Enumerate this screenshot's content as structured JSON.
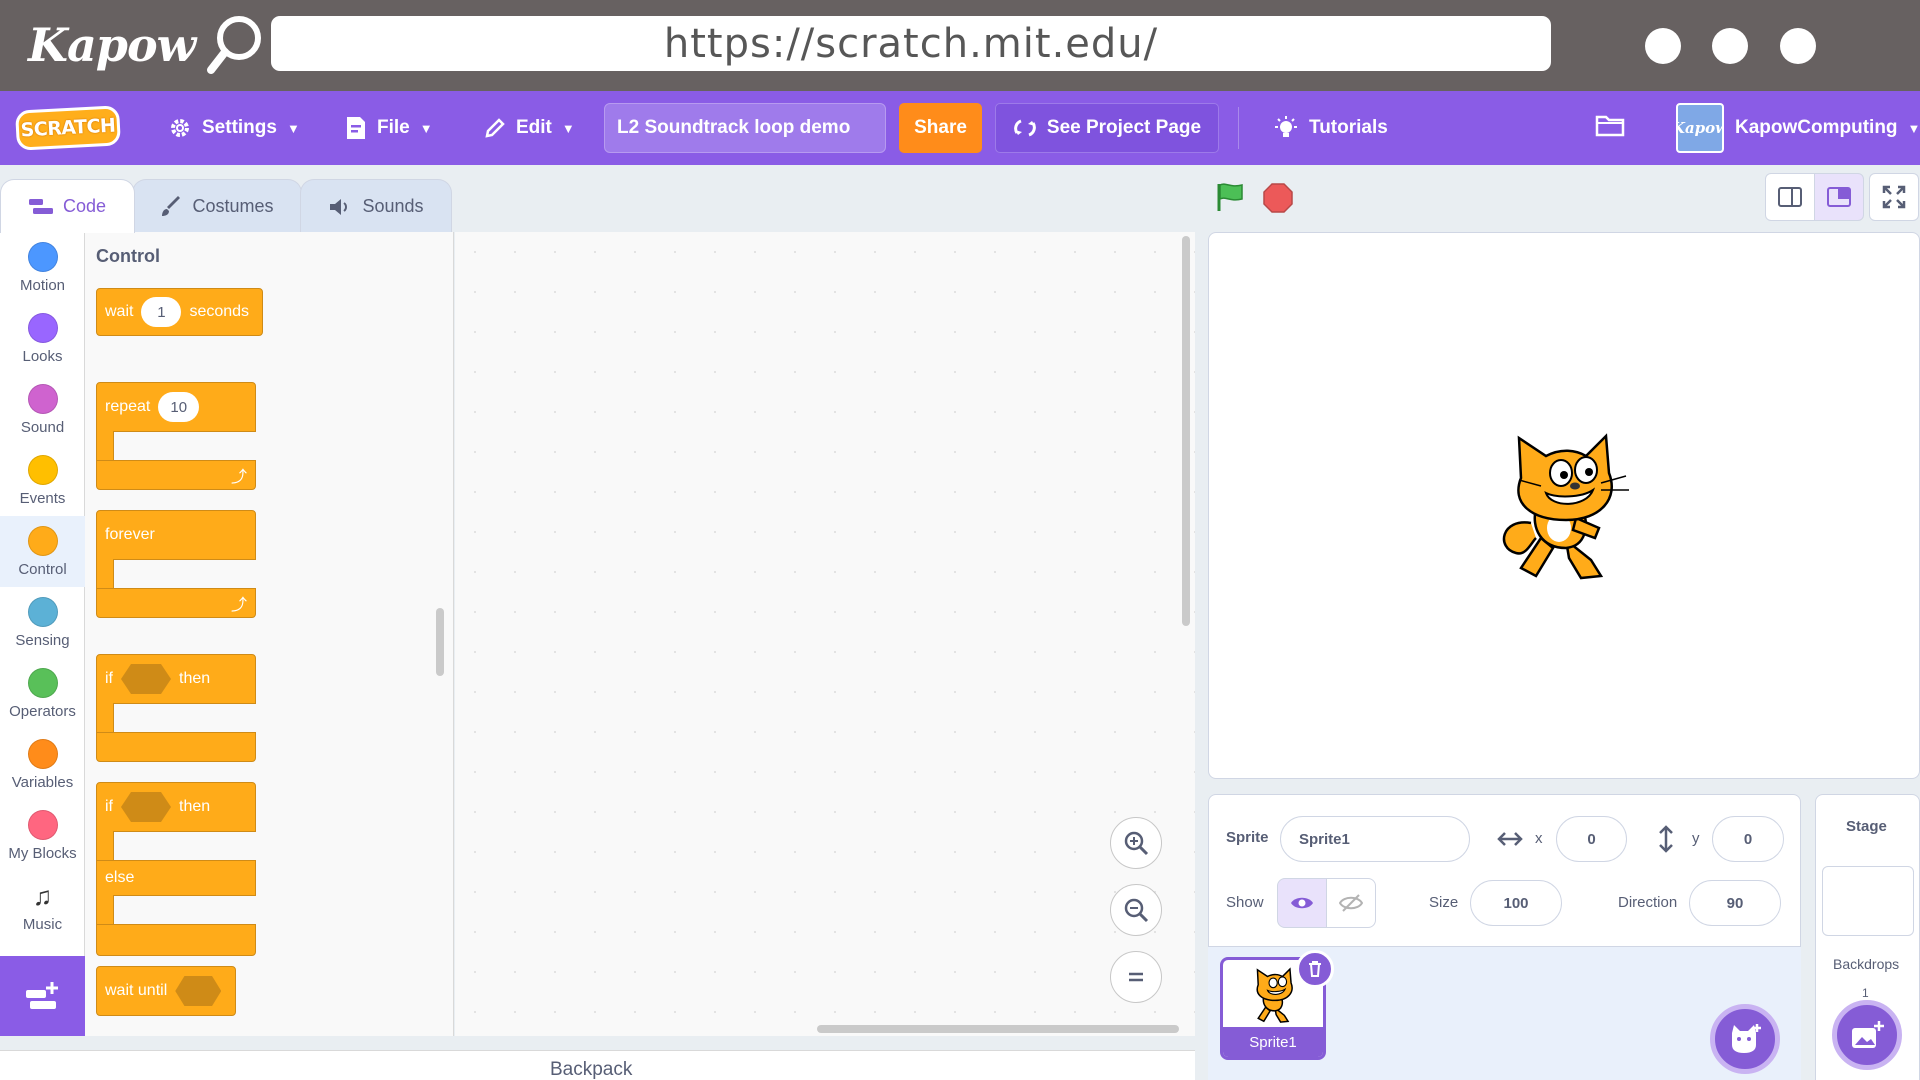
{
  "browser": {
    "brand_name": "Kapow",
    "url": "https://scratch.mit.edu/"
  },
  "menubar": {
    "logo_text": "SCRATCH",
    "settings_label": "Settings",
    "file_label": "File",
    "edit_label": "Edit",
    "project_title": "L2 Soundtrack loop demo",
    "share_label": "Share",
    "see_project_label": "See Project Page",
    "tutorials_label": "Tutorials",
    "username": "KapowComputing",
    "avatar_text": "Kapow"
  },
  "tabs": [
    {
      "label": "Code",
      "active": true
    },
    {
      "label": "Costumes",
      "active": false
    },
    {
      "label": "Sounds",
      "active": false
    }
  ],
  "categories": [
    {
      "label": "Motion",
      "color": "#4c97ff"
    },
    {
      "label": "Looks",
      "color": "#9966ff"
    },
    {
      "label": "Sound",
      "color": "#cf63cf"
    },
    {
      "label": "Events",
      "color": "#ffbf00"
    },
    {
      "label": "Control",
      "color": "#ffab19"
    },
    {
      "label": "Sensing",
      "color": "#5cb1d6"
    },
    {
      "label": "Operators",
      "color": "#59c059"
    },
    {
      "label": "Variables",
      "color": "#ff8c1a"
    },
    {
      "label": "My Blocks",
      "color": "#ff6680"
    },
    {
      "label": "Music",
      "icon": "music-notes-icon"
    }
  ],
  "palette": {
    "title": "Control",
    "wait": {
      "label": "wait",
      "value": "1",
      "unit": "seconds"
    },
    "repeat": {
      "label": "repeat",
      "value": "10"
    },
    "forever": {
      "label": "forever"
    },
    "if_then": {
      "if": "if",
      "then": "then"
    },
    "if_else": {
      "if": "if",
      "then": "then",
      "else": "else"
    },
    "wait_until": {
      "label": "wait until"
    }
  },
  "backpack": {
    "label": "Backpack"
  },
  "sprite_info": {
    "sprite_label": "Sprite",
    "sprite_name": "Sprite1",
    "x_label": "x",
    "x_value": "0",
    "y_label": "y",
    "y_value": "0",
    "show_label": "Show",
    "size_label": "Size",
    "size_value": "100",
    "direction_label": "Direction",
    "direction_value": "90"
  },
  "sprites": [
    {
      "name": "Sprite1",
      "selected": true
    }
  ],
  "stage_pane": {
    "title": "Stage",
    "backdrops_label": "Backdrops",
    "backdrops_count": "1"
  },
  "colors": {
    "scratch_purple": "#855cd6",
    "menubar": "#8a5ce6",
    "control_orange": "#ffab19",
    "share_orange": "#ff8c1a"
  }
}
